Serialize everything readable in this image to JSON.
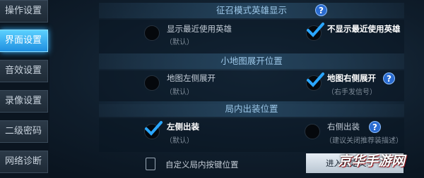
{
  "sidebar": {
    "items": [
      {
        "label": "操作设置",
        "active": false
      },
      {
        "label": "界面设置",
        "active": true
      },
      {
        "label": "音效设置",
        "active": false
      },
      {
        "label": "录像设置",
        "active": false
      },
      {
        "label": "二级密码",
        "active": false
      },
      {
        "label": "网络诊断",
        "active": false
      }
    ]
  },
  "sections": {
    "hero_display": {
      "title": "征召模式英雄显示",
      "show_recent": {
        "label": "显示最近使用英雄",
        "sub": "（默认）"
      },
      "hide_recent": {
        "label": "不显示最近使用英雄"
      },
      "selected": "hide_recent"
    },
    "minimap": {
      "title": "小地图展开位置",
      "left": {
        "label": "地图左侧展开",
        "sub": "（默认）"
      },
      "right": {
        "label": "地图右侧展开",
        "sub": "（右手发信号）"
      },
      "selected": "right"
    },
    "shop": {
      "title": "局内出装位置",
      "left": {
        "label": "左侧出装",
        "sub": "（默认）"
      },
      "right": {
        "label": "右侧出装",
        "sub": "（建议关闭推荐装描述）"
      },
      "selected": "left"
    }
  },
  "custom_keys": {
    "label": "自定义局内按键位置",
    "button": "进入自定义..."
  },
  "watermark": "京华手游网",
  "colors": {
    "accent": "#36b5ff",
    "check": "#2aa6ff"
  }
}
